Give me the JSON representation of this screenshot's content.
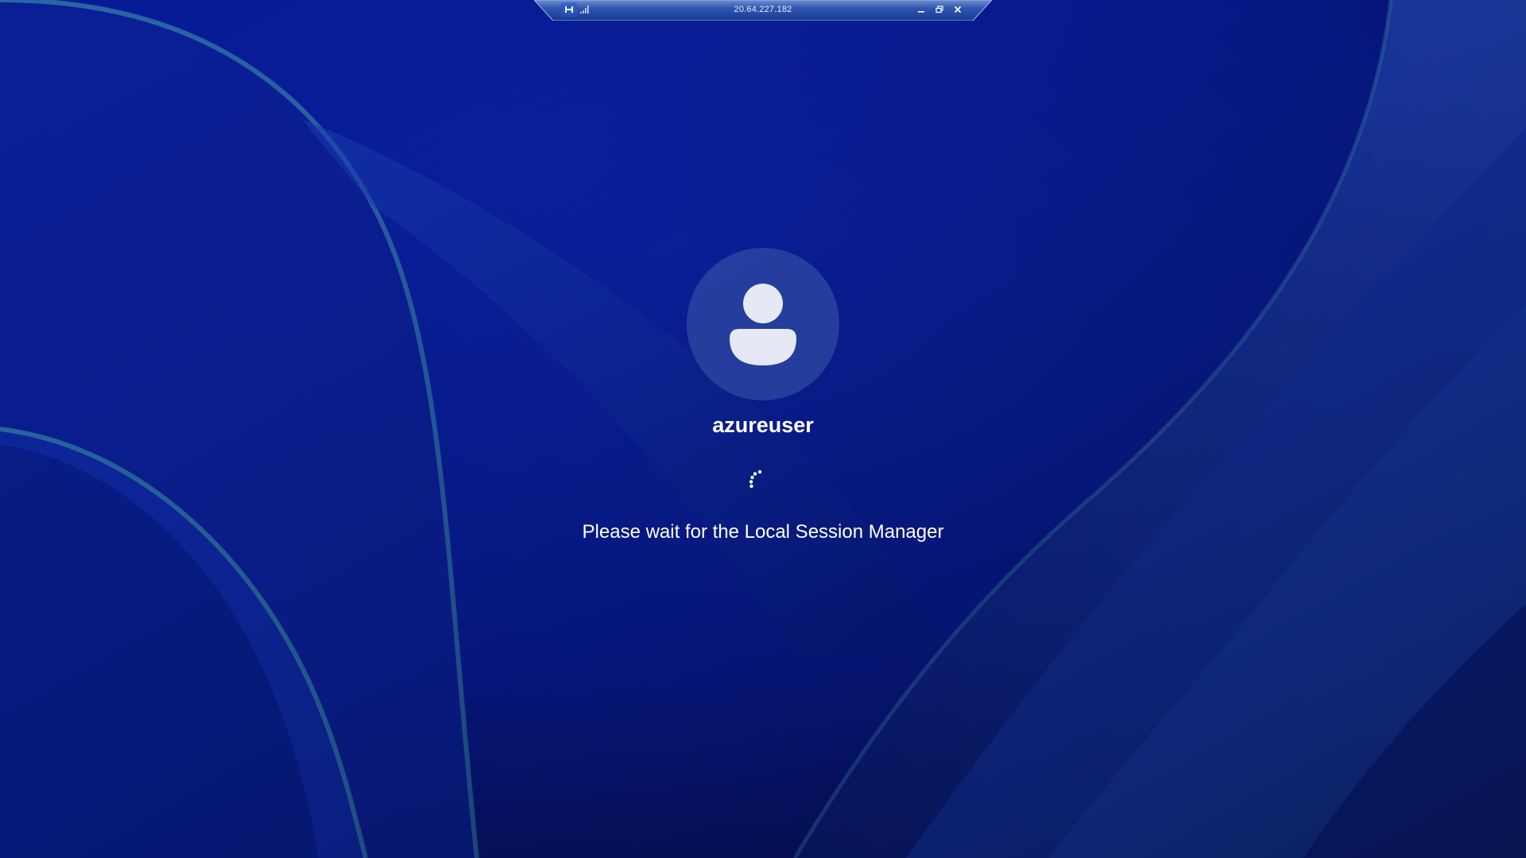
{
  "rdp_bar": {
    "host": "20.64.227.182",
    "buttons": {
      "pin_icon": "pin-icon",
      "signal_icon": "connection-quality-icon",
      "minimize_icon": "minimize-icon",
      "restore_icon": "restore-icon",
      "close_icon": "close-icon"
    }
  },
  "login": {
    "username": "azureuser",
    "status_message": "Please wait for the Local Session Manager",
    "avatar_icon": "user-avatar-icon",
    "spinner_icon": "loading-spinner-icon"
  },
  "colors": {
    "background": "#061a8c",
    "text": "#ffffff",
    "avatar_circle": "#2a3f8f",
    "avatar_glyph": "#e6e9f5"
  }
}
